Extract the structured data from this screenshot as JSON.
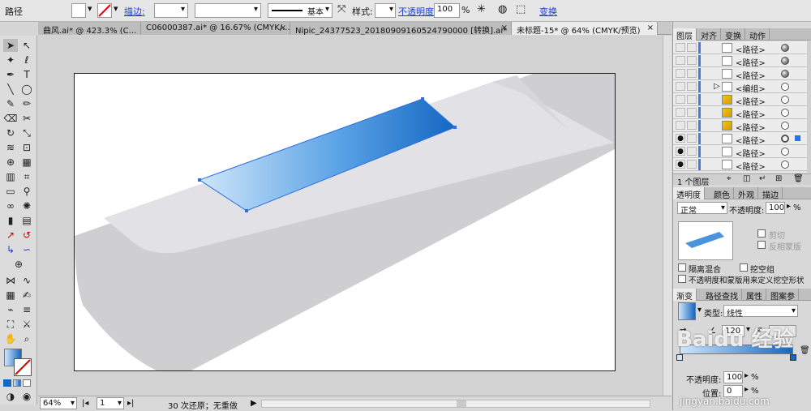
{
  "control_bar": {
    "object_type": "路径",
    "stroke_label": "描边:",
    "stroke_style": "基本",
    "style_label": "样式:",
    "opacity_label": "不透明度",
    "opacity_value": "100",
    "opacity_unit": "%",
    "transform_label": "变换"
  },
  "doc_tabs": [
    {
      "label": "曲风.ai* @ 423.3% (C..."
    },
    {
      "label": "C06000387.ai* @ 16.67% (CMYK/..."
    },
    {
      "label": "Nipic_24377523_20180909160524790000 [转换].ai*"
    },
    {
      "label": "未标题-15* @ 64% (CMYK/预览)"
    }
  ],
  "status_bar": {
    "zoom": "64%",
    "page": "1",
    "history": "30 次还原；无重做"
  },
  "layers_panel": {
    "tabs": [
      "图层",
      "对齐",
      "变换",
      "动作"
    ],
    "rows": [
      {
        "name": "<路径>",
        "visible": false,
        "thumb": "white",
        "target_filled": true
      },
      {
        "name": "<路径>",
        "visible": false,
        "thumb": "white",
        "target_filled": true
      },
      {
        "name": "<路径>",
        "visible": false,
        "thumb": "white",
        "target_filled": true
      },
      {
        "name": "<编组>",
        "visible": false,
        "thumb": "white",
        "target_filled": false
      },
      {
        "name": "<路径>",
        "visible": false,
        "thumb": "yellow",
        "target_filled": false
      },
      {
        "name": "<路径>",
        "visible": false,
        "thumb": "yellow",
        "target_filled": false
      },
      {
        "name": "<路径>",
        "visible": false,
        "thumb": "yellow",
        "target_filled": false
      },
      {
        "name": "<路径>",
        "visible": true,
        "thumb": "white",
        "target_filled": false
      },
      {
        "name": "<路径>",
        "visible": true,
        "thumb": "white",
        "target_filled": false
      },
      {
        "name": "<路径>",
        "visible": true,
        "thumb": "white",
        "target_filled": false
      }
    ],
    "footer": "1 个图层"
  },
  "transparency_panel": {
    "tabs": [
      "透明度",
      "颜色",
      "外观",
      "描边"
    ],
    "blend_mode": "正常",
    "opacity_label": "不透明度:",
    "opacity_value": "100",
    "opacity_unit": "%",
    "clip_label": "剪切",
    "invert_mask_label": "反相蒙版",
    "isolate_blend_label": "隔离混合",
    "knockout_group_label": "挖空组",
    "opacity_mask_label": "不透明度和蒙版用来定义挖空形状"
  },
  "gradient_panel": {
    "tabs": [
      "渐变",
      "路径查找",
      "属性",
      "图案参"
    ],
    "type_label": "类型:",
    "type_value": "线性",
    "angle_value": "120",
    "opacity_label": "不透明度:",
    "opacity_value": "100",
    "location_label": "位置:",
    "location_value": "0",
    "unit": "%"
  },
  "watermark": "Baidu 经验",
  "watermark_url": "jingyan.baidu.com",
  "colors": {
    "grad_light": "#cfe6fb",
    "grad_dark": "#1567c2",
    "selection": "#2d6fe0"
  }
}
